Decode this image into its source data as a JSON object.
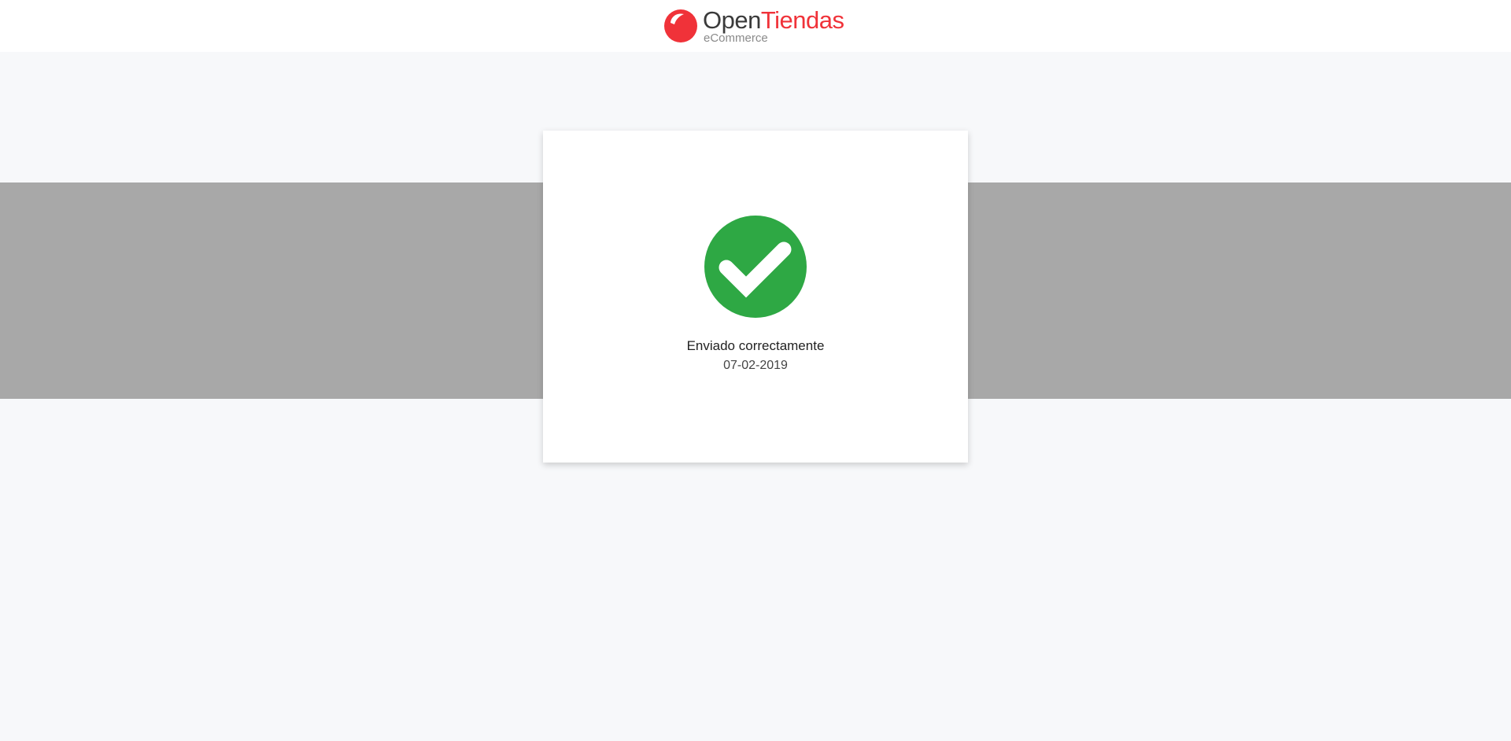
{
  "brand": {
    "name_part1": "Open",
    "name_part2": "Tiendas",
    "tagline": "eCommerce",
    "colors": {
      "primary_red": "#f03239",
      "dark_text": "#3a3a3a",
      "tagline_gray": "#8a8a8a"
    }
  },
  "confirmation": {
    "icon": "check-circle-icon",
    "icon_color": "#2ea844",
    "title": "Enviado correctamente",
    "date": "07-02-2019"
  }
}
